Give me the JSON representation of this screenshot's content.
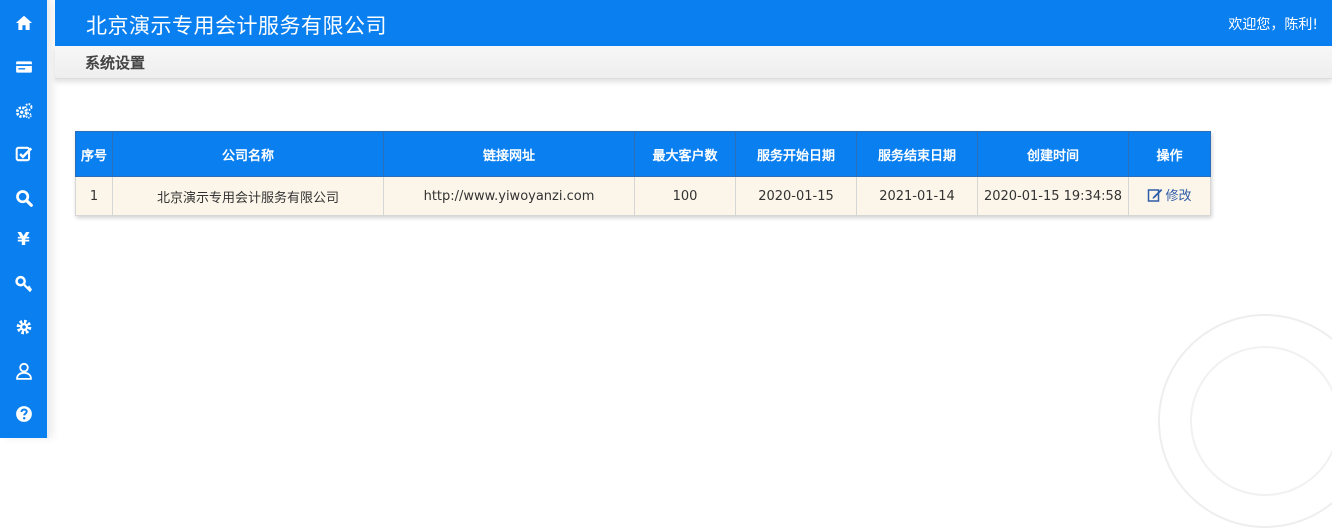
{
  "header": {
    "app_title": "北京演示专用会计服务有限公司",
    "welcome_text": "欢迎您，陈利!"
  },
  "breadcrumb": {
    "current": "系统设置"
  },
  "sidebar": {
    "icons": [
      "home-icon",
      "card-icon",
      "gears-icon",
      "check-square-icon",
      "search-icon",
      "yen-icon",
      "key-icon",
      "gear-icon",
      "user-icon",
      "help-icon"
    ],
    "yen_symbol": "¥"
  },
  "table": {
    "headers": [
      "序号",
      "公司名称",
      "链接网址",
      "最大客户数",
      "服务开始日期",
      "服务结束日期",
      "创建时间",
      "操作"
    ],
    "rows": [
      {
        "index": "1",
        "company": "北京演示专用会计服务有限公司",
        "url": "http://www.yiwoyanzi.com",
        "max_clients": "100",
        "start_date": "2020-01-15",
        "end_date": "2021-01-14",
        "created": "2020-01-15 19:34:58",
        "action": "修改"
      }
    ]
  },
  "colors": {
    "primary": "#0a7ff0",
    "row_bg": "#fcf6ea",
    "link": "#2f5da8"
  }
}
